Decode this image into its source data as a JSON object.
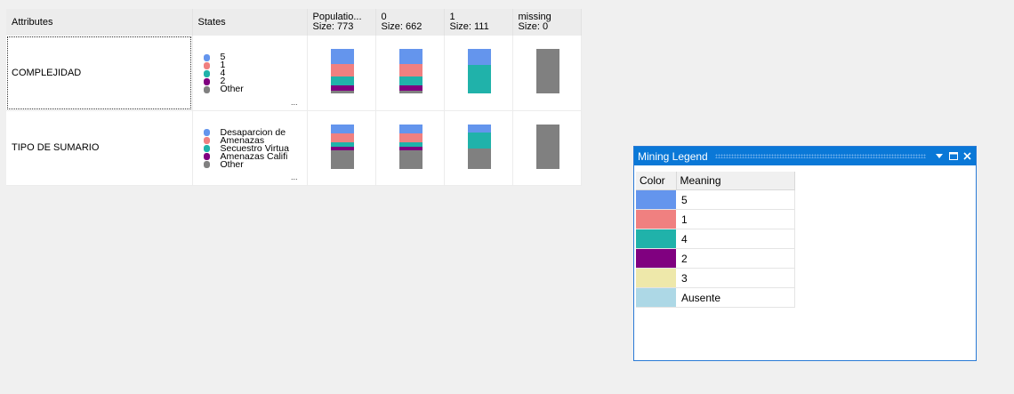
{
  "header": {
    "attributes": "Attributes",
    "states": "States",
    "columns": [
      {
        "line1": "Populatio...",
        "line2": "Size: 773"
      },
      {
        "line1": "0",
        "line2": "Size: 662"
      },
      {
        "line1": "1",
        "line2": "Size: 111"
      },
      {
        "line1": "missing",
        "line2": "Size: 0"
      }
    ]
  },
  "rows": [
    {
      "attribute": "COMPLEJIDAD",
      "states": [
        {
          "label": "5",
          "color": "#6495ed"
        },
        {
          "label": "1",
          "color": "#f08080"
        },
        {
          "label": "4",
          "color": "#20b2aa"
        },
        {
          "label": "2",
          "color": "#800080"
        },
        {
          "label": "Other",
          "color": "#808080"
        }
      ],
      "more": "...",
      "distributions": [
        [
          {
            "fraction": 0.34,
            "color": "#6495ed"
          },
          {
            "fraction": 0.28,
            "color": "#f08080"
          },
          {
            "fraction": 0.2,
            "color": "#20b2aa"
          },
          {
            "fraction": 0.12,
            "color": "#800080"
          },
          {
            "fraction": 0.06,
            "color": "#808080"
          }
        ],
        [
          {
            "fraction": 0.34,
            "color": "#6495ed"
          },
          {
            "fraction": 0.28,
            "color": "#f08080"
          },
          {
            "fraction": 0.2,
            "color": "#20b2aa"
          },
          {
            "fraction": 0.12,
            "color": "#800080"
          },
          {
            "fraction": 0.06,
            "color": "#808080"
          }
        ],
        [
          {
            "fraction": 0.36,
            "color": "#6495ed"
          },
          {
            "fraction": 0.64,
            "color": "#20b2aa"
          }
        ],
        [
          {
            "fraction": 1.0,
            "color": "#808080"
          }
        ]
      ]
    },
    {
      "attribute": "TIPO DE SUMARIO",
      "states": [
        {
          "label": "Desaparcion de",
          "color": "#6495ed"
        },
        {
          "label": "Amenazas",
          "color": "#f08080"
        },
        {
          "label": "Secuestro Virtua",
          "color": "#20b2aa"
        },
        {
          "label": "Amenazas Califi",
          "color": "#800080"
        },
        {
          "label": "Other",
          "color": "#808080"
        }
      ],
      "more": "...",
      "distributions": [
        [
          {
            "fraction": 0.2,
            "color": "#6495ed"
          },
          {
            "fraction": 0.2,
            "color": "#f08080"
          },
          {
            "fraction": 0.1,
            "color": "#20b2aa"
          },
          {
            "fraction": 0.08,
            "color": "#800080"
          },
          {
            "fraction": 0.42,
            "color": "#808080"
          }
        ],
        [
          {
            "fraction": 0.2,
            "color": "#6495ed"
          },
          {
            "fraction": 0.2,
            "color": "#f08080"
          },
          {
            "fraction": 0.1,
            "color": "#20b2aa"
          },
          {
            "fraction": 0.08,
            "color": "#800080"
          },
          {
            "fraction": 0.42,
            "color": "#808080"
          }
        ],
        [
          {
            "fraction": 0.18,
            "color": "#6495ed"
          },
          {
            "fraction": 0.36,
            "color": "#20b2aa"
          },
          {
            "fraction": 0.46,
            "color": "#808080"
          }
        ],
        [
          {
            "fraction": 1.0,
            "color": "#808080"
          }
        ]
      ]
    }
  ],
  "legend": {
    "title": "Mining Legend",
    "col_color": "Color",
    "col_meaning": "Meaning",
    "items": [
      {
        "meaning": "5",
        "color": "#6495ed"
      },
      {
        "meaning": "1",
        "color": "#f08080"
      },
      {
        "meaning": "4",
        "color": "#20b2aa"
      },
      {
        "meaning": "2",
        "color": "#800080"
      },
      {
        "meaning": "3",
        "color": "#eee8aa"
      },
      {
        "meaning": "Ausente",
        "color": "#add8e6"
      }
    ]
  }
}
